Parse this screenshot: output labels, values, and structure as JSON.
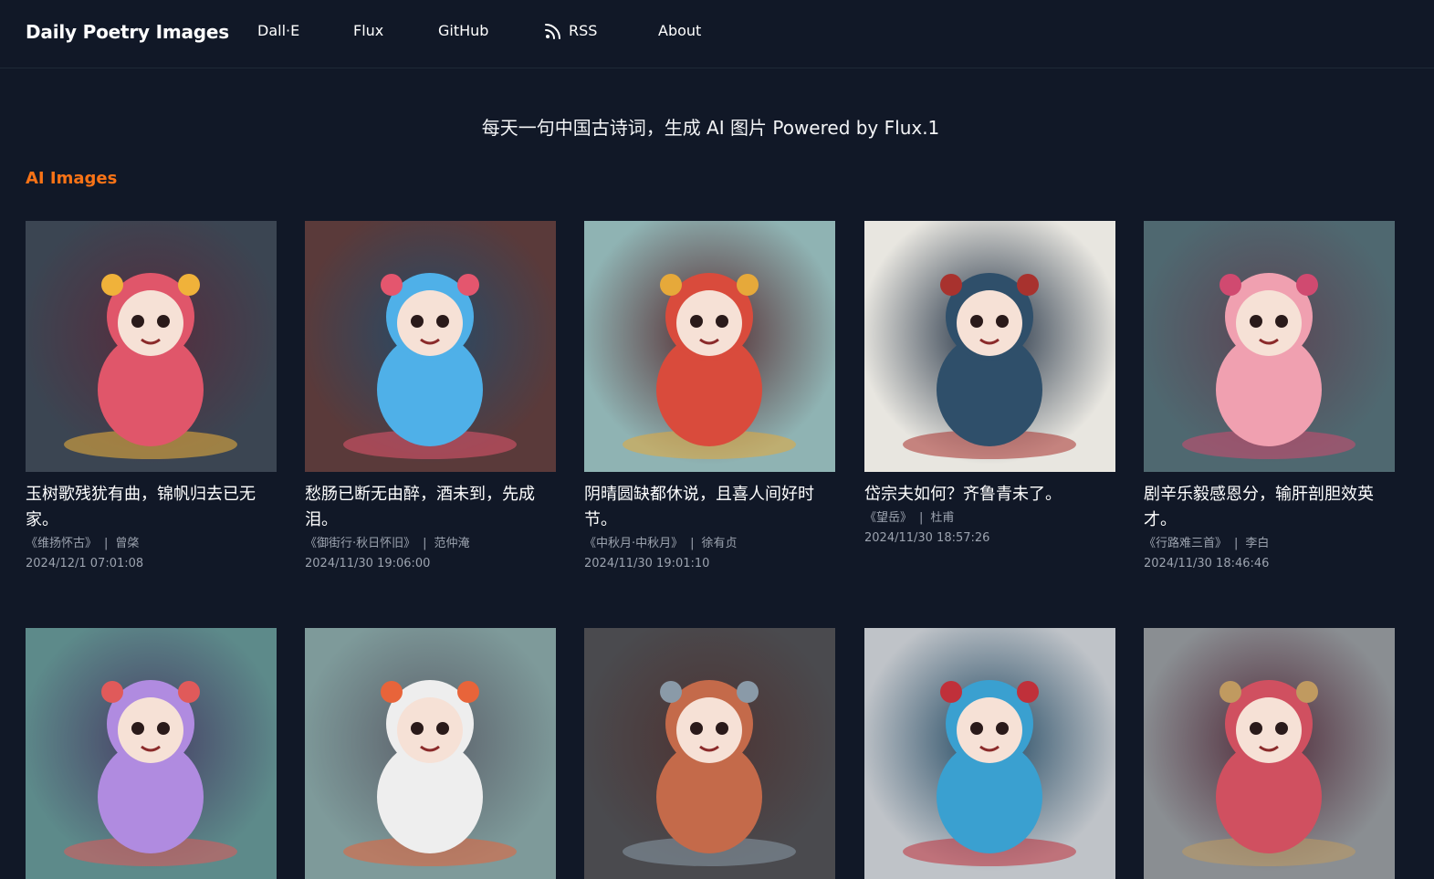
{
  "header": {
    "brand": "Daily Poetry Images",
    "nav": [
      {
        "label": "Dall·E",
        "icon": null
      },
      {
        "label": "Flux",
        "icon": null
      },
      {
        "label": "GitHub",
        "icon": null
      },
      {
        "label": "RSS",
        "icon": "rss-icon"
      },
      {
        "label": "About",
        "icon": null
      }
    ]
  },
  "tagline": "每天一句中国古诗词，生成 AI 图片 Powered by Flux.1",
  "section_title": "AI Images",
  "cards": [
    {
      "poem": "玉树歌残犹有曲，锦帆归去已无家。",
      "title": "《维扬怀古》",
      "author": "曾棨",
      "date": "2024/12/1 07:01:08",
      "image": "cartoon-ox-girl-figurine",
      "colors": [
        "#3b4552",
        "#e0566a",
        "#f0b23a"
      ]
    },
    {
      "poem": "愁肠已断无由醉，酒未到，先成泪。",
      "title": "《御街行·秋日怀旧》",
      "author": "范仲淹",
      "date": "2024/11/30 19:06:00",
      "image": "blue-haired-anime-girl",
      "colors": [
        "#5a3a3a",
        "#4fb0e8",
        "#e4566e"
      ]
    },
    {
      "poem": "阴晴圆缺都休说，且喜人间好时节。",
      "title": "《中秋月·中秋月》",
      "author": "徐有贞",
      "date": "2024/11/30 19:01:10",
      "image": "boy-with-headphones-figurine",
      "colors": [
        "#8fb3b3",
        "#d94b3c",
        "#e6a93a"
      ]
    },
    {
      "poem": "岱宗夫如何？齐鲁青未了。",
      "title": "《望岳》",
      "author": "杜甫",
      "date": "2024/11/30 18:57:26",
      "image": "old-sage-warrior-figurine",
      "colors": [
        "#e8e6e0",
        "#2f4f6a",
        "#a8322e"
      ]
    },
    {
      "poem": "剧辛乐毅感恩分，输肝剖胆效英才。",
      "title": "《行路难三首》",
      "author": "李白",
      "date": "2024/11/30 18:46:46",
      "image": "pink-dragon-figurine",
      "colors": [
        "#4f6870",
        "#f0a0b0",
        "#d04a70"
      ]
    },
    {
      "image": "purple-haired-girl-figurine",
      "colors": [
        "#5d8a8a",
        "#b08be0",
        "#e05a5a"
      ]
    },
    {
      "image": "white-fluffy-creature",
      "colors": [
        "#7e9a9a",
        "#eeeeee",
        "#e8643a"
      ]
    },
    {
      "image": "armored-warrior-figurine",
      "colors": [
        "#4a4a4e",
        "#c46a4a",
        "#8a9aa8"
      ]
    },
    {
      "image": "twin-tail-anime-figurine",
      "colors": [
        "#bfc3c8",
        "#3aa0d0",
        "#c0303a"
      ]
    },
    {
      "image": "red-haired-warrior-girl",
      "colors": [
        "#8a8e92",
        "#d05060",
        "#c09a60"
      ]
    }
  ]
}
